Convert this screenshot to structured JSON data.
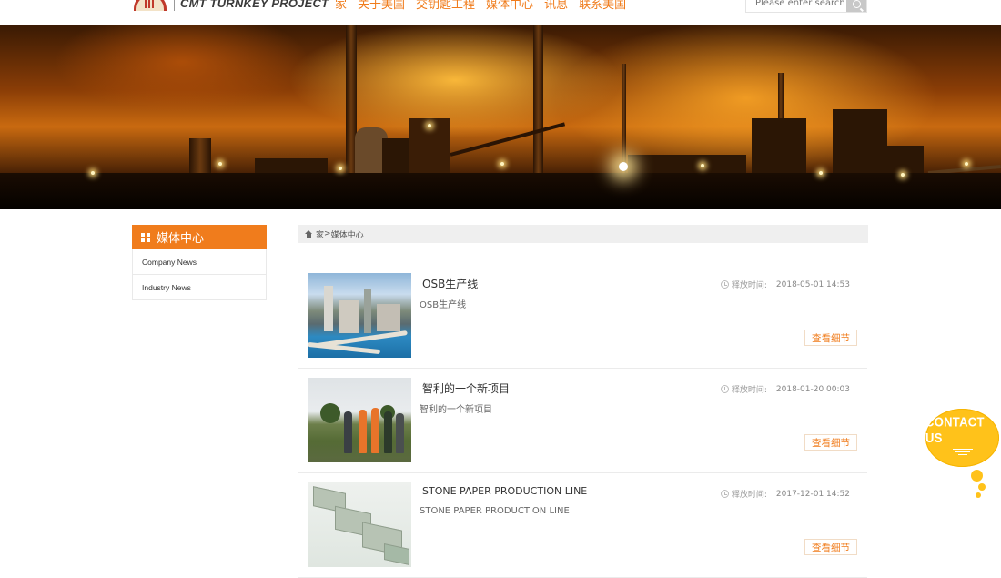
{
  "header": {
    "logo_text": "CMT TURNKEY PROJECT",
    "nav": [
      "家",
      "关于美国",
      "交钥匙工程",
      "媒体中心",
      "讯息",
      "联系美国"
    ],
    "search_placeholder": "Please enter search"
  },
  "sidebar": {
    "title": "媒体中心",
    "items": [
      "Company News",
      "Industry News"
    ]
  },
  "breadcrumb": {
    "home": "家",
    "separator": ">",
    "current": "媒体中心"
  },
  "news": [
    {
      "title": "OSB生产线",
      "summary": "OSB生产线",
      "date_label": "释放时间:",
      "date": "2018-05-01 14:53",
      "button": "查看细节"
    },
    {
      "title": "智利的一个新项目",
      "summary": "智利的一个新项目",
      "date_label": "释放时间:",
      "date": "2018-01-20 00:03",
      "button": "查看细节"
    },
    {
      "title": "STONE PAPER PRODUCTION LINE",
      "summary": "STONE PAPER PRODUCTION LINE",
      "date_label": "释放时间:",
      "date": "2017-12-01 14:52",
      "button": "查看细节"
    }
  ],
  "contact": {
    "label": "CONTACT US"
  },
  "colors": {
    "accent": "#f07c1c",
    "contact": "#ffc21a"
  }
}
